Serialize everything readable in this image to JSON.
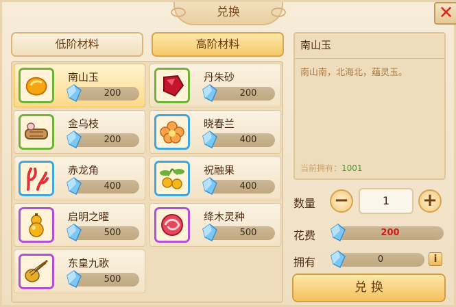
{
  "title": "兑换",
  "close_label": "✕",
  "tabs": [
    {
      "label": "低阶材料",
      "active": false
    },
    {
      "label": "高阶材料",
      "active": true
    }
  ],
  "items": [
    {
      "name": "南山玉",
      "cost": "200",
      "frame": "green",
      "icon": "jade-icon",
      "selected": true
    },
    {
      "name": "丹朱砂",
      "cost": "200",
      "frame": "green",
      "icon": "cinnabar-icon",
      "selected": false
    },
    {
      "name": "金乌枝",
      "cost": "200",
      "frame": "green",
      "icon": "branch-icon",
      "selected": false
    },
    {
      "name": "晓春兰",
      "cost": "400",
      "frame": "blue",
      "icon": "orchid-icon",
      "selected": false
    },
    {
      "name": "赤龙角",
      "cost": "400",
      "frame": "blue",
      "icon": "coral-horn-icon",
      "selected": false
    },
    {
      "name": "祝融果",
      "cost": "400",
      "frame": "blue",
      "icon": "fruit-icon",
      "selected": false
    },
    {
      "name": "启明之曜",
      "cost": "500",
      "frame": "purple",
      "icon": "gourd-icon",
      "selected": false
    },
    {
      "name": "绛木灵种",
      "cost": "500",
      "frame": "purple",
      "icon": "seed-orb-icon",
      "selected": false
    },
    {
      "name": "东皇九歌",
      "cost": "500",
      "frame": "purple",
      "icon": "pipa-icon",
      "selected": false
    }
  ],
  "detail": {
    "name": "南山玉",
    "description": "南山南，北海北，蕴灵玉。",
    "owned_label": "当前拥有：",
    "owned_value": "1001"
  },
  "quantity": {
    "label": "数量",
    "value": "1",
    "minus": "−",
    "plus": "+"
  },
  "cost_row": {
    "label": "花费",
    "value": "200",
    "color": "#d21a14"
  },
  "have_row": {
    "label": "拥有",
    "value": "0"
  },
  "info_label": "i",
  "exchange_label": "兑 换",
  "colors": {
    "accent": "#f7c96b",
    "owned_green": "#3aa028"
  }
}
